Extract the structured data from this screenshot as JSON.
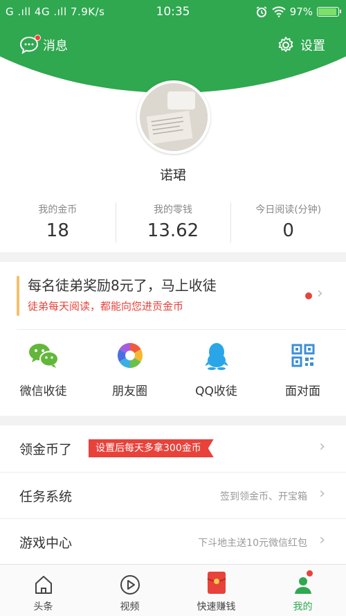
{
  "status_bar": {
    "network": "G .ıll 4G .ıll 7.9K/s",
    "time": "10:35",
    "battery": "97%"
  },
  "header": {
    "messages_label": "消息",
    "settings_label": "设置",
    "username": "诺珺"
  },
  "stats": [
    {
      "label": "我的金币",
      "value": "18"
    },
    {
      "label": "我的零钱",
      "value": "13.62"
    },
    {
      "label": "今日阅读(分钟)",
      "value": "0"
    }
  ],
  "promo": {
    "title": "每名徒弟奖励8元了，马上收徒",
    "subtitle": "徒弟每天阅读，都能向您进贡金币"
  },
  "share": [
    {
      "label": "微信收徒",
      "icon": "wechat-icon"
    },
    {
      "label": "朋友圈",
      "icon": "moments-icon"
    },
    {
      "label": "QQ收徒",
      "icon": "qq-icon"
    },
    {
      "label": "面对面",
      "icon": "qrcode-icon"
    }
  ],
  "list": [
    {
      "title": "领金币了",
      "tag": "设置后每天多拿300金币",
      "hint": ""
    },
    {
      "title": "任务系统",
      "tag": "",
      "hint": "签到领金币、开宝箱"
    },
    {
      "title": "游戏中心",
      "tag": "",
      "hint": "下斗地主送10元微信红包"
    }
  ],
  "tabs": [
    {
      "label": "头条",
      "icon": "home-icon"
    },
    {
      "label": "视频",
      "icon": "play-icon"
    },
    {
      "label": "快速赚钱",
      "icon": "red-envelope-icon"
    },
    {
      "label": "我的",
      "icon": "profile-icon"
    }
  ],
  "colors": {
    "brand_green": "#2fa84f",
    "accent_red": "#e8423a",
    "promo_bar": "#f4c06a"
  }
}
